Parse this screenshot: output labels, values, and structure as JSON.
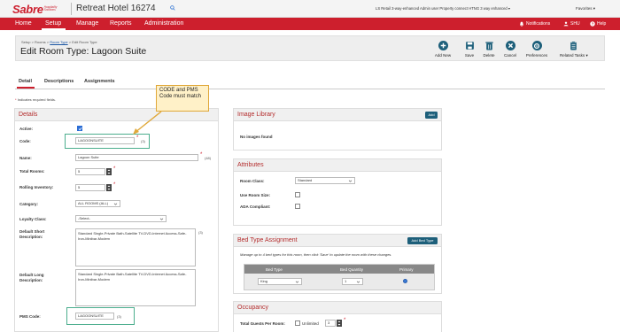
{
  "brand": {
    "logo_text": "Sabre",
    "logo_sub": "Hospitality Solutions",
    "hotel_name": "Retreat Hotel 16274",
    "top_right_info": "LS Retail 3-way-enhanced Admin user Property connect HTNG 3 way enhanced",
    "favorites_label": "Favorites"
  },
  "nav": {
    "items": [
      "Home",
      "Setup",
      "Manage",
      "Reports",
      "Administration"
    ],
    "active": "Setup",
    "notifications_label": "Notifications",
    "user_label": "SHU",
    "help_label": "Help"
  },
  "header": {
    "breadcrumb_setup": "Setup > Rooms >",
    "breadcrumb_room_type_link": "Room Type",
    "breadcrumb_tail": "> Edit Room Type",
    "title": "Edit Room Type: Lagoon Suite",
    "tools": [
      {
        "name": "add-new-button",
        "icon": "plus-icon",
        "label": "Add New",
        "color": "#1d5f7a"
      },
      {
        "name": "save-button",
        "icon": "floppy-icon",
        "label": "Save",
        "color": "#1d5f7a"
      },
      {
        "name": "delete-button",
        "icon": "trash-icon",
        "label": "Delete",
        "color": "#1d5f7a"
      },
      {
        "name": "cancel-button",
        "icon": "x-icon",
        "label": "Cancel",
        "color": "#1d5f7a"
      },
      {
        "name": "preferences-button",
        "icon": "gear-icon",
        "label": "Preferences",
        "color": "#1d5f7a"
      },
      {
        "name": "related-tasks-button",
        "icon": "clipboard-icon",
        "label": "Related Tasks",
        "color": "#1d5f7a"
      }
    ]
  },
  "tabs": {
    "items": [
      "Detail",
      "Descriptions",
      "Assignments"
    ],
    "active": "Detail",
    "required_note": "Indicates required fields."
  },
  "callout": {
    "text": "CODE and PMS Code must match"
  },
  "details": {
    "title": "Details",
    "active_label": "Active:",
    "active_checked": true,
    "code_label": "Code:",
    "code_value": "LAGOONSUITE",
    "code_count": "(3)",
    "name_label": "Name:",
    "name_value": "Lagoon Suite",
    "name_count": "(48)",
    "total_rooms_label": "Total Rooms:",
    "total_rooms_value": "5",
    "rolling_inventory_label": "Rolling Inventory:",
    "rolling_inventory_value": "5",
    "category_label": "Category:",
    "category_value": "ALL ROOMS (ALL)",
    "loyalty_class_label": "Loyalty Class:",
    "loyalty_class_value": "-Select-",
    "short_desc_label": "Default Short Description:",
    "short_desc_value": "Standard Single-Private Bath-Satellite TV-DVD-Internet Access-Safe-Iron-Minibar-Modem",
    "short_desc_count": "(3)",
    "long_desc_label": "Default Long Description:",
    "long_desc_value": "Standard Single-Private Bath-Satellite TV-DVD-Internet Access-Safe-Iron-Minibar-Modem",
    "pms_code_label": "PMS Code:",
    "pms_code_value": "LAGOONSUITE",
    "pms_code_count": "(3)"
  },
  "image_library": {
    "title": "Image Library",
    "add_label": "Add",
    "empty_text": "No images found"
  },
  "attributes": {
    "title": "Attributes",
    "room_class_label": "Room Class:",
    "room_class_value": "Standard",
    "use_room_size_label": "Use Room Size:",
    "use_room_size_checked": false,
    "ada_label": "ADA Compliant:",
    "ada_checked": false
  },
  "bed_type": {
    "title": "Bed Type Assignment",
    "add_label": "Add Bed Type",
    "instructions": "Manage up to 4 bed types for this room, then click 'Save' to update the room with these changes.",
    "col_bed_type": "Bed Type",
    "col_quantity": "Bed Quantity",
    "col_primary": "Primary",
    "row_bed_type": "King",
    "row_quantity": "1",
    "row_primary": true
  },
  "occupancy": {
    "title": "Occupancy",
    "total_guests_label": "Total Guests Per Room:",
    "unlimited_label": "Unlimited",
    "total_guests_value": "3"
  },
  "colors": {
    "brand_red": "#cd1f2d",
    "header_accent": "#b42d2d",
    "teal": "#1d5f7a",
    "highlight_green": "#4cae8e"
  }
}
